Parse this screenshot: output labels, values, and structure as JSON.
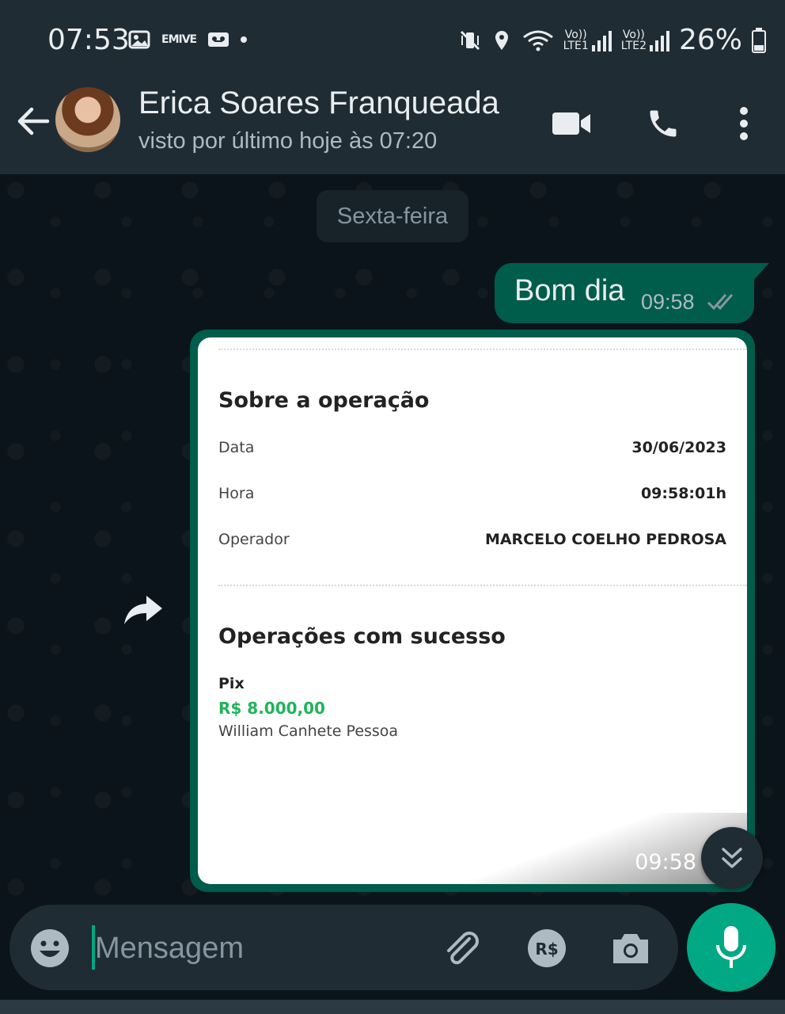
{
  "status_bar": {
    "time": "07:53",
    "left_icons": [
      "gallery-icon",
      "emive-icon",
      "voicemail-icon",
      "dot-icon"
    ],
    "emive_label": "EMIVE",
    "lte1": {
      "top": "Vo))",
      "bottom": "LTE1"
    },
    "lte2": {
      "top": "Vo))",
      "bottom": "LTE2"
    },
    "battery": "26%"
  },
  "header": {
    "contact_name": "Erica Soares Franqueada",
    "status": "visto por último hoje às 07:20",
    "icons": [
      "back-arrow-icon",
      "video-call-icon",
      "phone-icon",
      "more-vert-icon"
    ]
  },
  "chat": {
    "date_chip": "Sexta-feira",
    "outgoing_message": {
      "text": "Bom dia",
      "time": "09:58",
      "status": "read"
    },
    "image_message": {
      "time": "09:58",
      "receipt": {
        "section1_title": "Sobre a operação",
        "rows": [
          {
            "label": "Data",
            "value": "30/06/2023"
          },
          {
            "label": "Hora",
            "value": "09:58:01h"
          },
          {
            "label": "Operador",
            "value": "MARCELO COELHO PEDROSA"
          }
        ],
        "section2_title": "Operações com sucesso",
        "operation_type": "Pix",
        "amount": "R$ 8.000,00",
        "recipient": "William Canhete Pessoa"
      }
    }
  },
  "composer": {
    "placeholder": "Mensagem",
    "value": ""
  },
  "colors": {
    "header_bg": "#1f2c34",
    "chat_bg": "#0b141a",
    "outgoing_bubble": "#005c4b",
    "accent": "#00a884",
    "amount_green": "#21b35b"
  }
}
